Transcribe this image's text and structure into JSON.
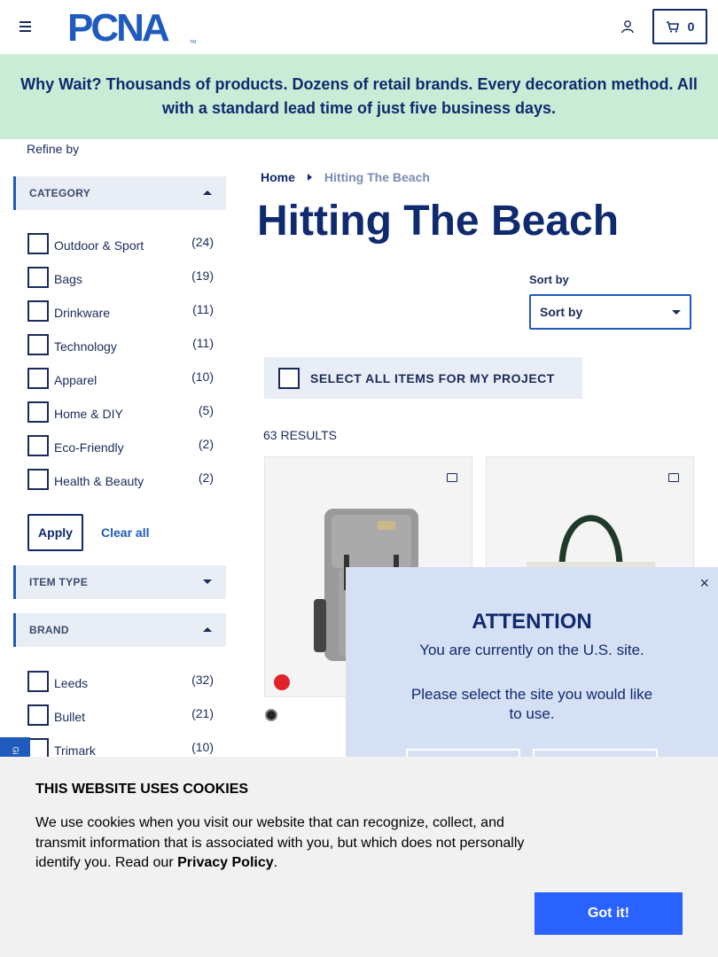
{
  "header": {
    "logo_text": "PCNA",
    "cart_count": "0"
  },
  "banner": {
    "text": "Why Wait? Thousands of products. Dozens of retail brands. Every decoration method. All with a standard lead time of just five business days."
  },
  "sidebar": {
    "refine_label": "Refine by",
    "category": {
      "title": "CATEGORY",
      "items": [
        {
          "label": "Outdoor & Sport",
          "count": "(24)"
        },
        {
          "label": "Bags",
          "count": "(19)"
        },
        {
          "label": "Drinkware",
          "count": "(11)"
        },
        {
          "label": "Technology",
          "count": "(11)"
        },
        {
          "label": "Apparel",
          "count": "(10)"
        },
        {
          "label": "Home & DIY",
          "count": "(5)"
        },
        {
          "label": "Eco-Friendly",
          "count": "(2)"
        },
        {
          "label": "Health & Beauty",
          "count": "(2)"
        }
      ]
    },
    "apply_label": "Apply",
    "clear_label": "Clear all",
    "item_type": {
      "title": "ITEM TYPE"
    },
    "brand": {
      "title": "BRAND",
      "items": [
        {
          "label": "Leeds",
          "count": "(32)"
        },
        {
          "label": "Bullet",
          "count": "(21)"
        },
        {
          "label": "Trimark",
          "count": "(10)"
        }
      ]
    }
  },
  "main": {
    "breadcrumb": {
      "home": "Home",
      "current": "Hitting The Beach"
    },
    "title": "Hitting The Beach",
    "sort_label": "Sort by",
    "sort_value": "Sort by",
    "select_all_label": "SELECT ALL ITEMS FOR MY PROJECT",
    "results": "63 RESULTS"
  },
  "attention": {
    "close": "×",
    "title": "ATTENTION",
    "line1": "You are currently on the U.S. site.",
    "line2": "Please select the site you would like to use."
  },
  "side_tab": {
    "label": "Gi"
  },
  "cookie": {
    "title": "THIS WEBSITE USES COOKIES",
    "text": "We use cookies when you visit our website that can recognize, collect, and transmit information that is associated with you, but which does not personally identify you. Read our",
    "link": "Privacy Policy",
    "period": ".",
    "button": "Got it!"
  },
  "colors": {
    "brand_navy": "#0f2a6e",
    "accent_blue": "#1f5bbd",
    "banner_green": "#c9ecd6",
    "cookie_button": "#2962ff",
    "modal_bg": "#d6e0f5"
  }
}
